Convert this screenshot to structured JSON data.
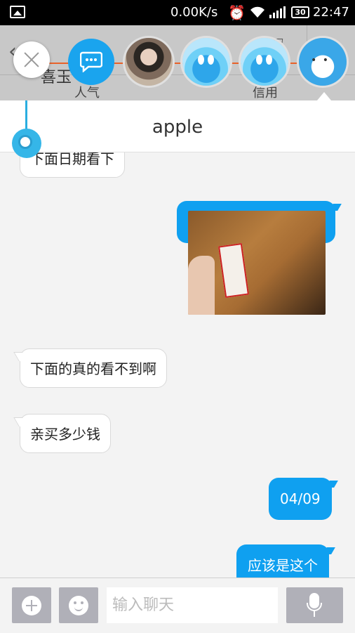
{
  "status_bar": {
    "net_speed": "0.00K/s",
    "battery": "30",
    "time": "22:47"
  },
  "background_header": {
    "shop_name": "喜玉",
    "tab_popularity": "人气",
    "tab_credit": "信用",
    "filter_label": "筛选"
  },
  "chat": {
    "contact_name": "apple",
    "messages": [
      {
        "side": "in",
        "text": "下面日期看下"
      },
      {
        "side": "out",
        "type": "image"
      },
      {
        "side": "in",
        "text": "下面的真的看不到啊"
      },
      {
        "side": "in",
        "text": "亲买多少钱"
      },
      {
        "side": "out",
        "text": "04/09"
      },
      {
        "side": "out",
        "text": "应该是这个"
      }
    ]
  },
  "input_bar": {
    "placeholder": "输入聊天"
  },
  "icons": {
    "gallery": "gallery-icon",
    "alarm": "alarm-icon",
    "wifi": "wifi-icon",
    "signal": "signal-icon",
    "back": "back-arrow-icon",
    "filter": "filter-icon",
    "close": "close-icon",
    "message": "message-bubble-icon",
    "add": "plus-icon",
    "emoji": "smiley-icon",
    "mic": "microphone-icon"
  },
  "colors": {
    "accent_blue": "#0fa0f0",
    "head_line_orange": "#e8622a"
  }
}
